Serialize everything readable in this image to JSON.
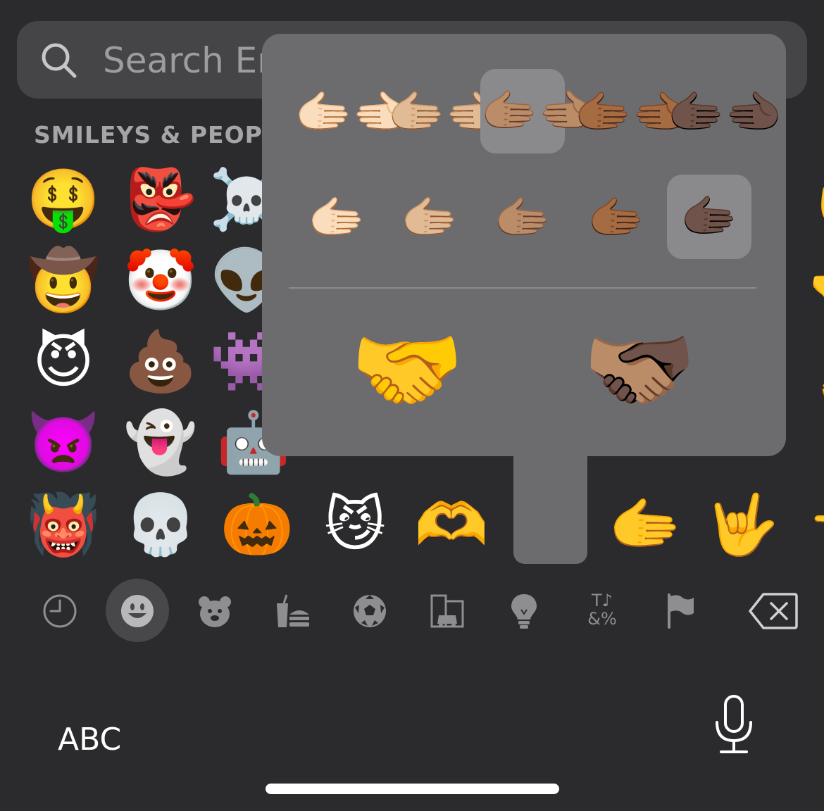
{
  "search": {
    "placeholder": "Search Em"
  },
  "section": {
    "title": "SMILEYS & PEOPL"
  },
  "grid": {
    "row1": [
      "🤑",
      "👺",
      "☠️"
    ],
    "row2": [
      "🤠",
      "🤡",
      "👽"
    ],
    "row3": [
      "😈",
      "💩",
      "👾"
    ],
    "row4": [
      "👿",
      "👻",
      "🤖",
      "😯",
      "😢",
      "😊",
      "😊"
    ],
    "row5": [
      "👹",
      "💀",
      "🎃",
      "😼",
      "🫶",
      "🫱",
      "🤟",
      "✋"
    ],
    "edge": [
      "✋",
      "🫳",
      "👌",
      "👈"
    ]
  },
  "popover": {
    "row1": [
      "🫱🏻‍🫲🏻",
      "🫱🏼‍🫲🏼",
      "🫱🏽‍🫲🏽",
      "🫱🏾‍🫲🏾",
      "🫱🏿‍🫲🏿"
    ],
    "row2": [
      "🫱🏻",
      "🫱🏼",
      "🫱🏽",
      "🫱🏾",
      "🫱🏿"
    ],
    "big_default": "🤝",
    "big_combo": "🫱🏽‍🫲🏿"
  },
  "categories": [
    "clock-icon",
    "smiley-icon",
    "animal-icon",
    "food-icon",
    "ball-icon",
    "travel-icon",
    "lightbulb-icon",
    "symbols-icon",
    "flag-icon"
  ],
  "symbols_glyph": "T♪\n&%",
  "keyboard": {
    "abc_label": "ABC"
  }
}
